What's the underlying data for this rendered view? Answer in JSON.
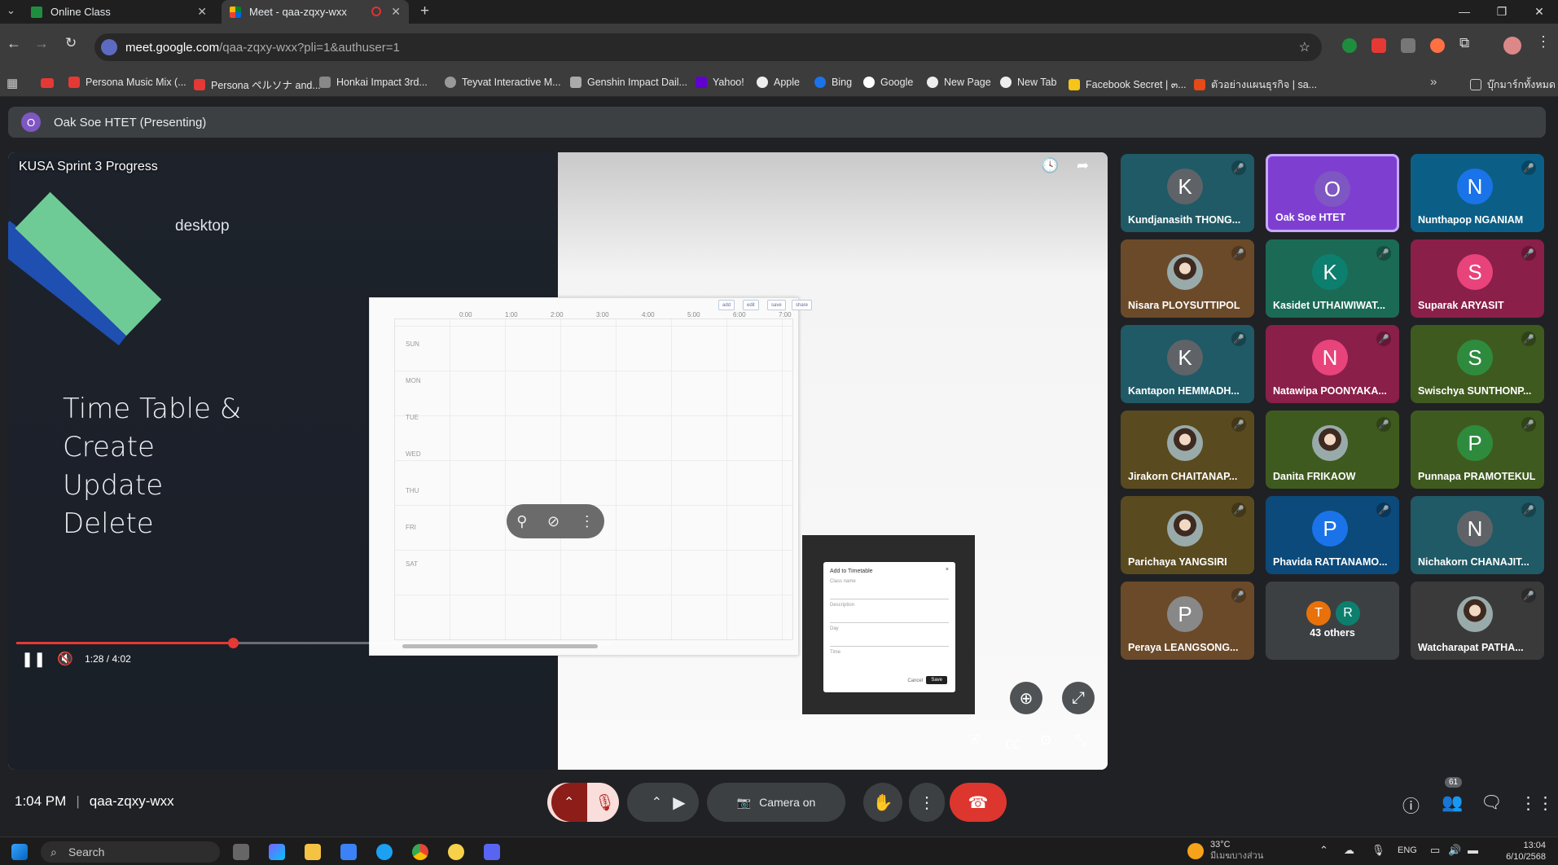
{
  "browser": {
    "tabs": [
      {
        "title": "Online Class",
        "active": false
      },
      {
        "title": "Meet - qaa-zqxy-wxx",
        "active": true
      }
    ],
    "url_host": "meet.google.com",
    "url_path": "/qaa-zqxy-wxx?pli=1&authuser=1",
    "bookmarks": [
      "Persona Music Mix (...",
      "Persona ペルソナ and...",
      "Honkai Impact 3rd...",
      "Teyvat Interactive M...",
      "Genshin Impact Dail...",
      "Yahoo!",
      "Apple",
      "Bing",
      "Google",
      "New Page",
      "New Tab",
      "Facebook Secret | ๓...",
      "ตัวอย่างแผนธุรกิจ | sa..."
    ],
    "other_bookmarks": "บุ๊กมาร์กทั้งหมด"
  },
  "meet": {
    "presenter_initial": "O",
    "presenting_label": "Oak Soe HTET (Presenting)",
    "video": {
      "title": "KUSA Sprint 3 Progress",
      "slide_heading": "Time Table &\nCreate\nUpdate\nDelete",
      "slide_tag": "desktop",
      "time": "1:28 / 4:02",
      "progress": 0.365
    },
    "timetable": {
      "hours": [
        "0:00",
        "1:00",
        "2:00",
        "3:00",
        "4:00",
        "5:00",
        "6:00",
        "7:00"
      ],
      "days": [
        "SUN",
        "MON",
        "TUE",
        "WED",
        "THU",
        "FRI",
        "SAT"
      ],
      "buttons": [
        "add",
        "edit",
        "save",
        "share"
      ],
      "modal_title": "Add to Timetable",
      "modal_fields": [
        "Class name",
        "Description",
        "Day",
        "Time"
      ],
      "modal_cancel": "Cancel",
      "modal_save": "Save"
    },
    "participants": [
      {
        "name": "Kundjanasith THONG...",
        "initial": "K",
        "color": "#5f6368",
        "bg": "#1f5a66",
        "mic_muted": true
      },
      {
        "name": "Oak Soe HTET",
        "initial": "O",
        "color": "#7e57c2",
        "bg": "#7e3fd1",
        "mic_muted": false
      },
      {
        "name": "Nunthapop NGANIAM",
        "initial": "N",
        "color": "#1a73e8",
        "bg": "#0b5f86",
        "mic_muted": true
      },
      {
        "name": "Nisara PLOYSUTTIPOL",
        "initial": "",
        "color": "#888",
        "bg": "#6b4a2a",
        "mic_muted": true,
        "photo": true
      },
      {
        "name": "Kasidet UTHAIWIWAT...",
        "initial": "K",
        "color": "#0d7f6e",
        "bg": "#1b6a55",
        "mic_muted": true
      },
      {
        "name": "Suparak ARYASIT",
        "initial": "S",
        "color": "#e8437b",
        "bg": "#8a1f49",
        "mic_muted": true
      },
      {
        "name": "Kantapon HEMMADH...",
        "initial": "K",
        "color": "#5f6368",
        "bg": "#1f5a66",
        "mic_muted": true
      },
      {
        "name": "Natawipa POONYAKA...",
        "initial": "N",
        "color": "#e8437b",
        "bg": "#8a1f49",
        "mic_muted": true
      },
      {
        "name": "Swischya SUNTHONP...",
        "initial": "S",
        "color": "#2e8b3e",
        "bg": "#3f5a1f",
        "mic_muted": true
      },
      {
        "name": "Jirakorn CHAITANAP...",
        "initial": "",
        "color": "#888",
        "bg": "#5a4a1f",
        "mic_muted": true,
        "photo": true
      },
      {
        "name": "Danita FRIKAOW",
        "initial": "",
        "color": "#888",
        "bg": "#3f5a1f",
        "mic_muted": true,
        "photo": true
      },
      {
        "name": "Punnapa PRAMOTEKUL",
        "initial": "P",
        "color": "#2e8b3e",
        "bg": "#3f5a1f",
        "mic_muted": true
      },
      {
        "name": "Parichaya YANGSIRI",
        "initial": "",
        "color": "#888",
        "bg": "#5a4a1f",
        "mic_muted": true,
        "photo": true
      },
      {
        "name": "Phavida RATTANAMO...",
        "initial": "P",
        "color": "#1a73e8",
        "bg": "#0b4a7a",
        "mic_muted": true
      },
      {
        "name": "Nichakorn CHANAJIT...",
        "initial": "N",
        "color": "#5f6368",
        "bg": "#1f5a66",
        "mic_muted": true
      },
      {
        "name": "Peraya LEANGSONG...",
        "initial": "P",
        "color": "#888",
        "bg": "#6b4a2a",
        "mic_muted": true
      },
      {
        "name": "43 others",
        "initial": "",
        "color": "#3c4043",
        "bg": "#3c4043",
        "mic_muted": false,
        "others": [
          "T",
          "R"
        ]
      },
      {
        "name": "Watcharapat PATHA...",
        "initial": "",
        "color": "#888",
        "bg": "#3a3a3a",
        "mic_muted": true,
        "photo": true
      }
    ],
    "clock": "1:04 PM",
    "meeting_code": "qaa-zqxy-wxx",
    "camera_tooltip": "Camera on",
    "people_count": "61"
  },
  "taskbar": {
    "search": "Search",
    "weather_temp": "33°C",
    "weather_desc": "มีเมฆบางส่วน",
    "lang": "ENG",
    "time": "13:04",
    "date": "6/10/2568"
  }
}
